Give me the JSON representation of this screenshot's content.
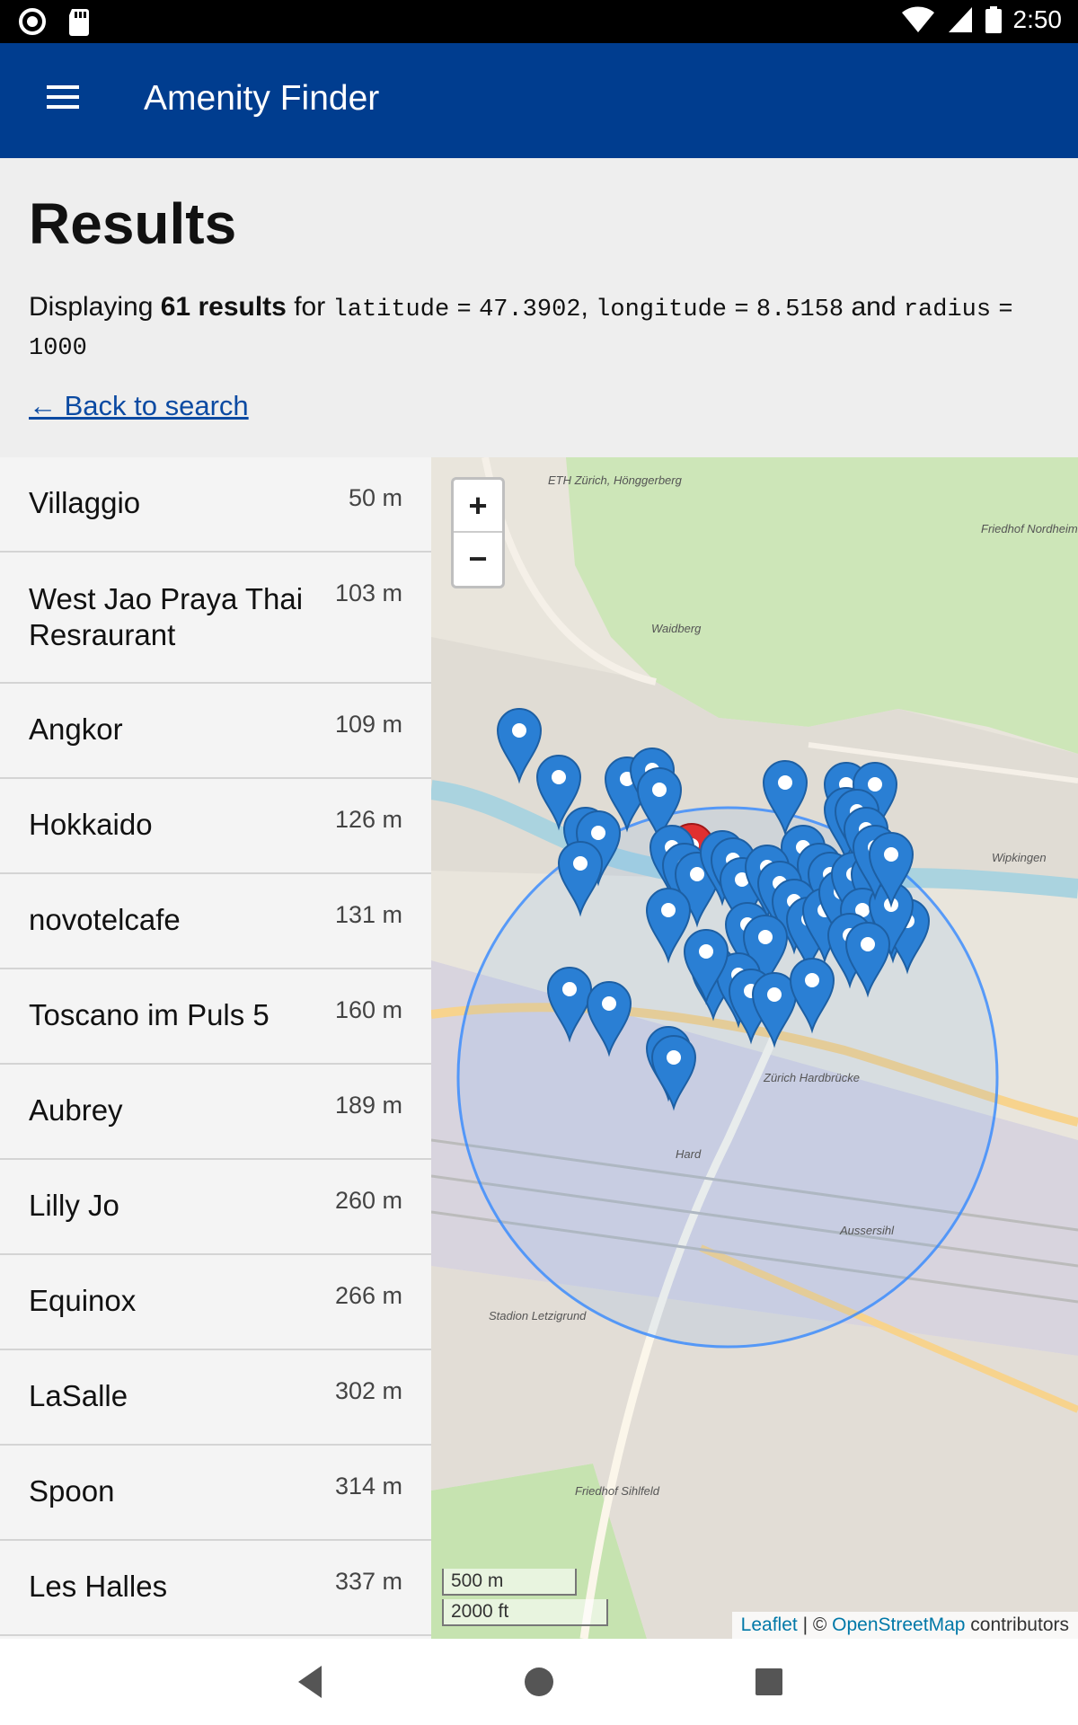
{
  "status_bar": {
    "time": "2:50"
  },
  "app_bar": {
    "title": "Amenity Finder"
  },
  "page": {
    "heading": "Results",
    "summary": {
      "prefix": "Displaying",
      "count": "61 results",
      "for": "for",
      "lat_key": "latitude",
      "eq1": "=",
      "lat_val": "47.3902",
      "comma1": ",",
      "lon_key": "longitude",
      "eq2": "=",
      "lon_val": "8.5158",
      "and": "and",
      "rad_key": "radius",
      "eq3": "=",
      "rad_val": "1000"
    },
    "back_link": "← Back to search"
  },
  "results": [
    {
      "name": "Villaggio",
      "distance": "50 m"
    },
    {
      "name": "West Jao Praya Thai Resraurant",
      "distance": "103 m"
    },
    {
      "name": "Angkor",
      "distance": "109 m"
    },
    {
      "name": "Hokkaido",
      "distance": "126 m"
    },
    {
      "name": "novotelcafe",
      "distance": "131 m"
    },
    {
      "name": "Toscano im Puls 5",
      "distance": "160 m"
    },
    {
      "name": "Aubrey",
      "distance": "189 m"
    },
    {
      "name": "Lilly Jo",
      "distance": "260 m"
    },
    {
      "name": "Equinox",
      "distance": "266 m"
    },
    {
      "name": "LaSalle",
      "distance": "302 m"
    },
    {
      "name": "Spoon",
      "distance": "314 m"
    },
    {
      "name": "Les Halles",
      "distance": "337 m"
    }
  ],
  "map": {
    "zoom_in": "+",
    "zoom_out": "−",
    "scale_metric": "500 m",
    "scale_imperial": "2000 ft",
    "attribution_leaflet": "Leaflet",
    "attribution_sep": " | © ",
    "attribution_osm": "OpenStreetMap",
    "attribution_suffix": " contributors",
    "labels": {
      "eth": "ETH Zürich, Hönggerberg",
      "friedhof_nordheim": "Friedhof Nordheim",
      "waidberg": "Waidberg",
      "wipkingen": "Wipkingen",
      "hardbruecke": "Zürich Hardbrücke",
      "aussersihl": "Aussersihl",
      "sihlfeld": "Friedhof Sihlfeld",
      "stadion": "Stadion Letzigrund",
      "hard": "Hard"
    },
    "colors": {
      "marker": "#2a7fd4",
      "marker_dark": "#1d5fa3",
      "center_marker": "#e03030",
      "radius_circle": "#3388ff"
    }
  },
  "nav": {
    "back": "back-icon",
    "home": "home-icon",
    "recents": "recents-icon"
  }
}
